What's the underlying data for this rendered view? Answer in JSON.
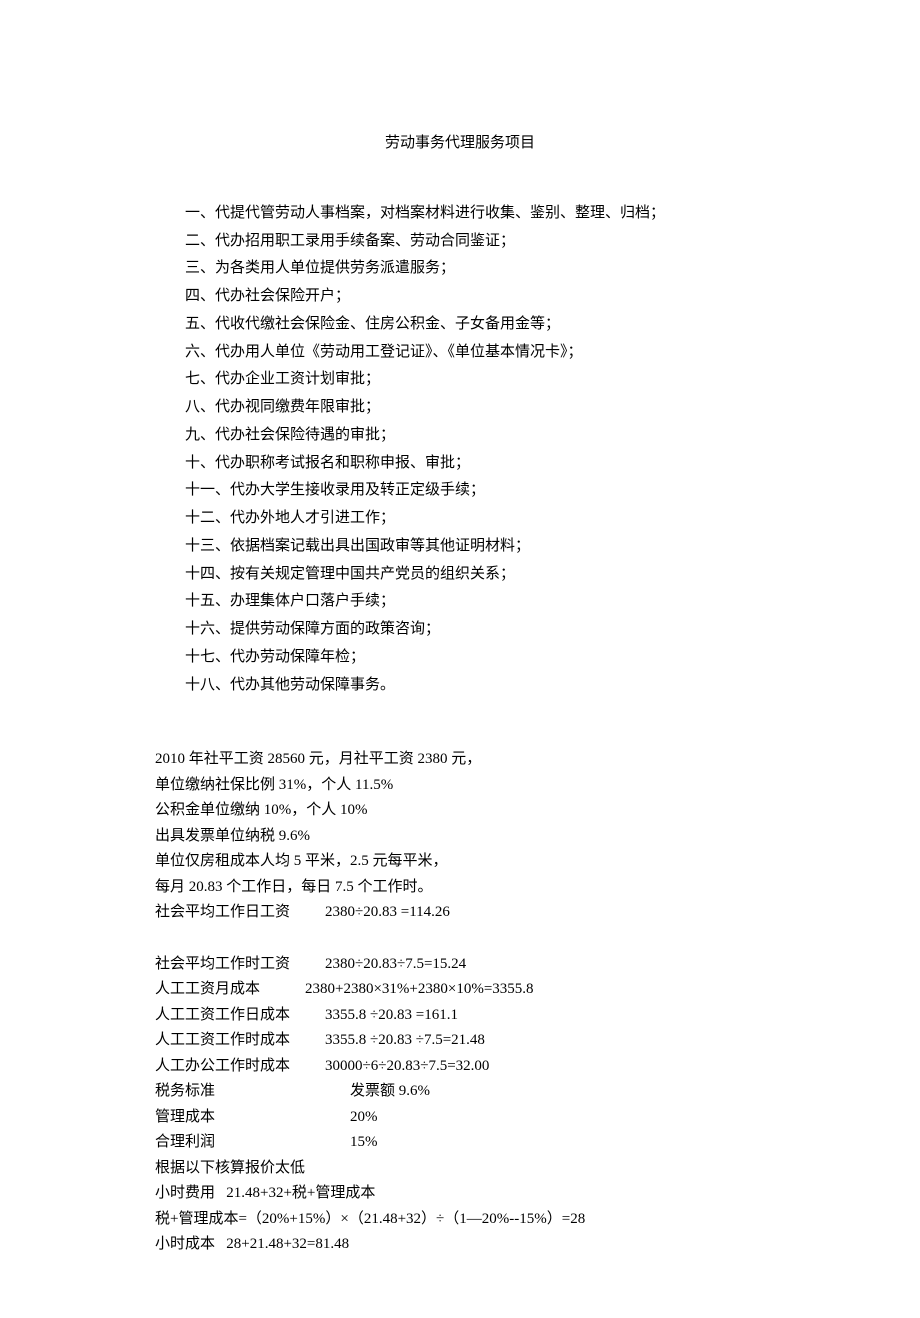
{
  "title": "劳动事务代理服务项目",
  "services": {
    "item1": "一、代提代管劳动人事档案，对档案材料进行收集、鉴别、整理、归档；",
    "item2": "二、代办招用职工录用手续备案、劳动合同鉴证；",
    "item3": "三、为各类用人单位提供劳务派遣服务；",
    "item4": "四、代办社会保险开户；",
    "item5": "五、代收代缴社会保险金、住房公积金、子女备用金等；",
    "item6": "六、代办用人单位《劳动用工登记证》、《单位基本情况卡》；",
    "item7": "七、代办企业工资计划审批；",
    "item8": "八、代办视同缴费年限审批；",
    "item9": "九、代办社会保险待遇的审批；",
    "item10": "十、代办职称考试报名和职称申报、审批；",
    "item11": "十一、代办大学生接收录用及转正定级手续；",
    "item12": "十二、代办外地人才引进工作；",
    "item13": "十三、依据档案记载出具出国政审等其他证明材料；",
    "item14": "十四、按有关规定管理中国共产党员的组织关系；",
    "item15": "十五、办理集体户口落户手续；",
    "item16": "十六、提供劳动保障方面的政策咨询；",
    "item17": "十七、代办劳动保障年检；",
    "item18": "十八、代办其他劳动保障事务。"
  },
  "calc": {
    "line1": "2010 年社平工资 28560 元，月社平工资 2380 元，",
    "line2": "单位缴纳社保比例 31%，个人 11.5%",
    "line3": "公积金单位缴纳 10%，个人 10%",
    "line4": "出具发票单位纳税 9.6%",
    "line5": "单位仅房租成本人均 5 平米，2.5 元每平米，",
    "line6": "每月 20.83 个工作日，每日 7.5 个工作时。",
    "line7_label": "社会平均工作日工资",
    "line7_value": "2380÷20.83 =114.26",
    "line8_label": "社会平均工作时工资",
    "line8_value": "2380÷20.83÷7.5=15.24",
    "line9_label": "人工工资月成本",
    "line9_value": "2380+2380×31%+2380×10%=3355.8",
    "line10_label": "人工工资工作日成本",
    "line10_value": "3355.8 ÷20.83 =161.1",
    "line11_label": "人工工资工作时成本",
    "line11_value": "3355.8 ÷20.83 ÷7.5=21.48",
    "line12_label": "人工办公工作时成本",
    "line12_value": "30000÷6÷20.83÷7.5=32.00",
    "line13_label": "税务标准",
    "line13_value": "发票额 9.6%",
    "line14_label": "管理成本",
    "line14_value": "20%",
    "line15_label": "合理利润",
    "line15_value": "15%",
    "line16": "根据以下核算报价太低",
    "line17": "小时费用   21.48+32+税+管理成本",
    "line18": "税+管理成本=（20%+15%）×（21.48+32）÷（1—20%--15%）=28",
    "line19": "小时成本   28+21.48+32=81.48"
  }
}
